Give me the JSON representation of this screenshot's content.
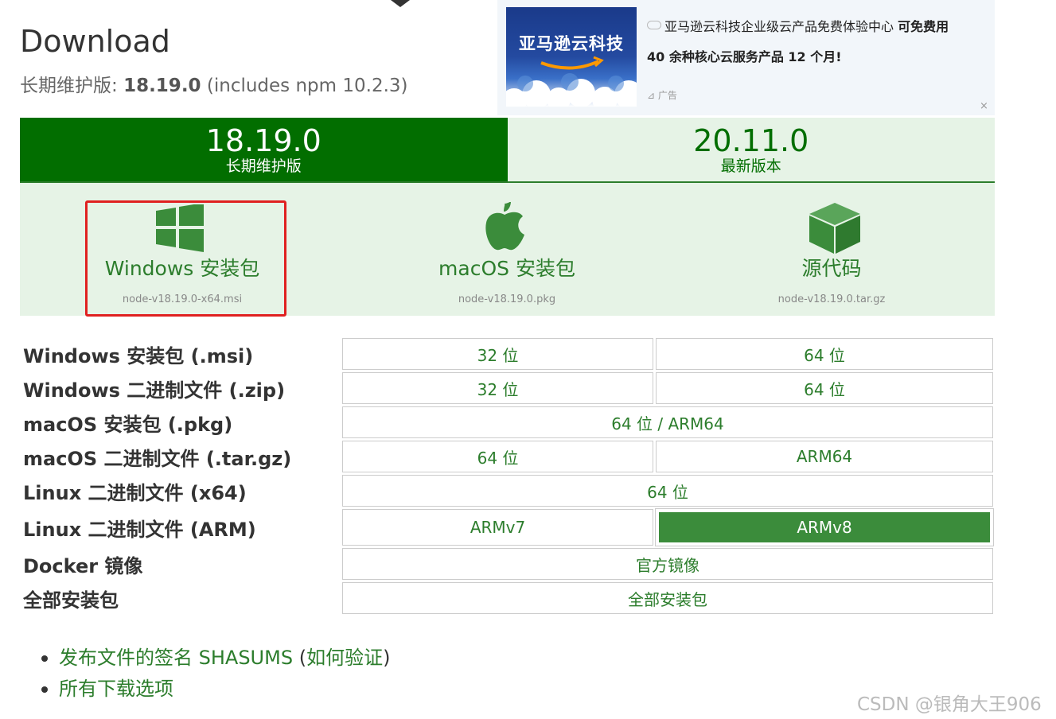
{
  "header": {
    "title": "Download",
    "subtitle_prefix": "长期维护版: ",
    "subtitle_version": "18.19.0",
    "subtitle_suffix": " (includes npm 10.2.3)"
  },
  "ad": {
    "image_title": "亚马逊云科技",
    "line1": "亚马逊云科技企业级云产品免费体验中心 ",
    "line1_bold": "可免费用",
    "line2": "40 余种核心云服务产品 12 个月!",
    "tag": "广告",
    "close": "×"
  },
  "tabs": [
    {
      "version": "18.19.0",
      "label": "长期维护版"
    },
    {
      "version": "20.11.0",
      "label": "最新版本"
    }
  ],
  "downloads": [
    {
      "name": "Windows 安装包",
      "file": "node-v18.19.0-x64.msi"
    },
    {
      "name": "macOS 安装包",
      "file": "node-v18.19.0.pkg"
    },
    {
      "name": "源代码",
      "file": "node-v18.19.0.tar.gz"
    }
  ],
  "table": {
    "rows": [
      {
        "label": "Windows 安装包 (.msi)",
        "cells": [
          "32 位",
          "64 位"
        ]
      },
      {
        "label": "Windows 二进制文件 (.zip)",
        "cells": [
          "32 位",
          "64 位"
        ]
      },
      {
        "label": "macOS 安装包 (.pkg)",
        "cells": [
          "64 位 / ARM64"
        ]
      },
      {
        "label": "macOS 二进制文件 (.tar.gz)",
        "cells": [
          "64 位",
          "ARM64"
        ]
      },
      {
        "label": "Linux 二进制文件 (x64)",
        "cells": [
          "64 位"
        ]
      },
      {
        "label": "Linux 二进制文件 (ARM)",
        "cells": [
          "ARMv7",
          "ARMv8"
        ]
      },
      {
        "label": "Docker 镜像",
        "cells": [
          "官方镜像"
        ]
      },
      {
        "label": "全部安装包",
        "cells": [
          "全部安装包"
        ]
      }
    ]
  },
  "links": {
    "shasums": "发布文件的签名 SHASUMS",
    "open_paren": " (",
    "verify": "如何验证",
    "close_paren": ")",
    "all_options": "所有下载选项"
  },
  "watermark": "CSDN @银角大王906",
  "colors": {
    "brand_green": "#026e00",
    "link_green": "#2c7d2c",
    "panel_bg": "#e6f3e6",
    "highlight": "#e02020"
  }
}
